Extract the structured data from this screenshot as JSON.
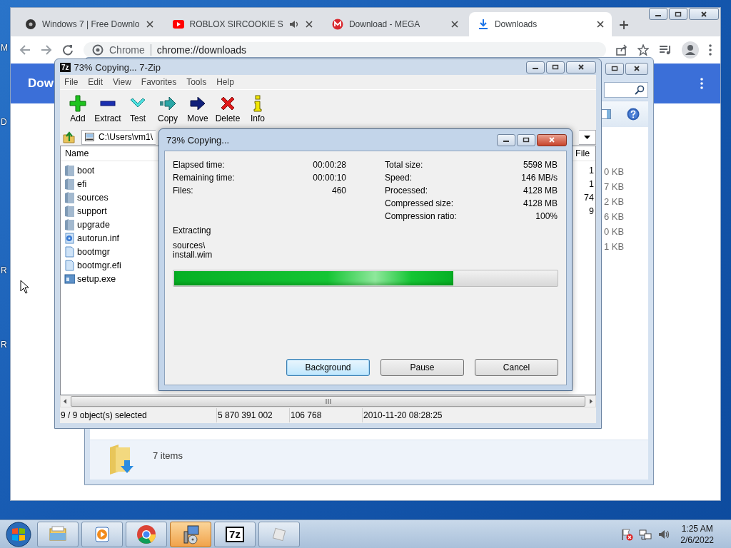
{
  "desktop": {
    "icon_labels": [
      "M",
      "D",
      "R",
      "R"
    ]
  },
  "browser": {
    "tabs": [
      {
        "title": "Windows 7 | Free Downlo",
        "kind": "disc",
        "selected": false,
        "audio": false
      },
      {
        "title": "ROBLOX SIRCOOKIE S",
        "kind": "video",
        "selected": false,
        "audio": true
      },
      {
        "title": "Download - MEGA",
        "kind": "mega",
        "selected": false,
        "audio": false
      },
      {
        "title": "Downloads",
        "kind": "download",
        "selected": true,
        "audio": false
      }
    ],
    "address": {
      "site": "Chrome",
      "url": "chrome://downloads"
    },
    "page_title": "Dow"
  },
  "explorer": {
    "sizes": [
      "0 KB",
      "7 KB",
      "2 KB",
      "6 KB",
      "0 KB",
      "1 KB"
    ],
    "item_count": "7 items"
  },
  "archive": {
    "logo": "7z",
    "title": "73% Copying... 7-Zip",
    "menu": [
      "File",
      "Edit",
      "View",
      "Favorites",
      "Tools",
      "Help"
    ],
    "toolbar": [
      {
        "label": "Add",
        "kind": "add"
      },
      {
        "label": "Extract",
        "kind": "extract"
      },
      {
        "label": "Test",
        "kind": "test"
      },
      {
        "label": "Copy",
        "kind": "copy"
      },
      {
        "label": "Move",
        "kind": "move"
      },
      {
        "label": "Delete",
        "kind": "delete"
      },
      {
        "label": "Info",
        "kind": "info"
      }
    ],
    "path": "C:\\Users\\vm1\\",
    "columns": [
      "Name",
      "File"
    ],
    "files": [
      {
        "name": "boot",
        "kind": "folder",
        "column_2": "1"
      },
      {
        "name": "efi",
        "kind": "folder",
        "column_2": "1"
      },
      {
        "name": "sources",
        "kind": "folder",
        "column_2": "74"
      },
      {
        "name": "support",
        "kind": "folder",
        "column_2": "9"
      },
      {
        "name": "upgrade",
        "kind": "folder"
      },
      {
        "name": "autorun.inf",
        "kind": "settings"
      },
      {
        "name": "bootmgr",
        "kind": "file"
      },
      {
        "name": "bootmgr.efi",
        "kind": "file"
      },
      {
        "name": "setup.exe",
        "kind": "program"
      }
    ],
    "status_bar": [
      "9 / 9 object(s) selected",
      "5 870 391 002",
      "106 768",
      "2010-11-20 08:28:25"
    ]
  },
  "dialog": {
    "title": "73% Copying...",
    "stats_left": [
      {
        "label": "Elapsed time:",
        "value": "00:00:28"
      },
      {
        "label": "Remaining time:",
        "value": "00:00:10"
      },
      {
        "label": "Files:",
        "value": "460"
      }
    ],
    "stats_right": [
      {
        "label": "Total size:",
        "value": "5598 MB"
      },
      {
        "label": "Speed:",
        "value": "146 MB/s"
      },
      {
        "label": "Processed:",
        "value": "4128 MB"
      },
      {
        "label": "Compressed size:",
        "value": "4128 MB"
      },
      {
        "label": "Compression ratio:",
        "value": "100%"
      }
    ],
    "action": "Extracting",
    "current_file": [
      "sources\\",
      "install.wim"
    ],
    "progress": {
      "level": 0.73
    },
    "buttons": [
      {
        "label": "Background",
        "selected": true
      },
      {
        "label": "Pause",
        "selected": false
      },
      {
        "label": "Cancel",
        "selected": false
      }
    ]
  },
  "taskbar": {
    "apps": [
      {
        "kind": "explorer",
        "highlighted": false
      },
      {
        "kind": "media",
        "highlighted": false
      },
      {
        "kind": "chrome",
        "highlighted": false
      },
      {
        "kind": "installer",
        "highlighted": true
      },
      {
        "kind": "sevenzip",
        "label": "7z",
        "highlighted": false
      },
      {
        "kind": "roblox",
        "highlighted": false
      }
    ],
    "time": "1:25 AM",
    "date": "2/6/2022"
  }
}
